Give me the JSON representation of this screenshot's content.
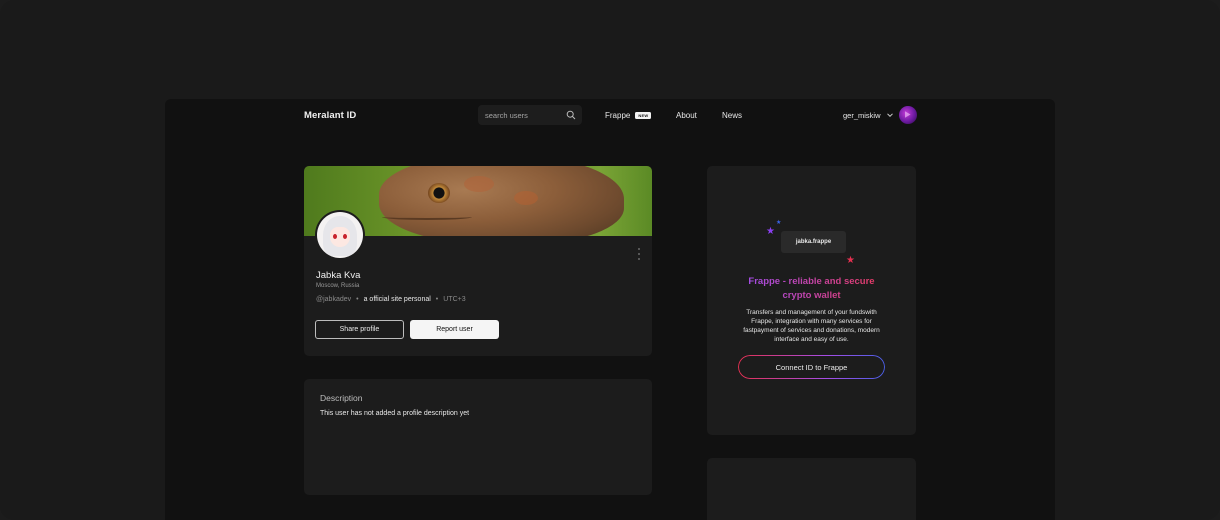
{
  "nav": {
    "brand": "Meralant ID",
    "search_placeholder": "search users",
    "links": {
      "frappe": "Frappe",
      "frappe_badge": "NEW",
      "about": "About",
      "news": "News"
    },
    "user": {
      "name": "ger_miskiw"
    }
  },
  "profile": {
    "display_name": "Jabka Kva",
    "location": "Moscow, Russia",
    "handle": "@jabkadev",
    "site_label": "a official site personal",
    "timezone": "UTC+3",
    "share_label": "Share profile",
    "report_label": "Report user"
  },
  "description": {
    "title": "Description",
    "text": "This user has not added a profile description yet"
  },
  "promo": {
    "wallet_chip": "jabka.frappe",
    "title_line1": "Frappe - reliable and secure",
    "title_line2": "crypto wallet",
    "text": "Transfers and management of your fundswith Frappe, integration with many services for fastpayment of services and donations, modern interface and easy of use.",
    "connect_label": "Connect ID to Frappe"
  },
  "colors": {
    "background": "#111111",
    "card": "#1c1c1c",
    "accent_purple": "#a64de6",
    "accent_red": "#e33c68",
    "accent_blue": "#4a5fe6"
  }
}
